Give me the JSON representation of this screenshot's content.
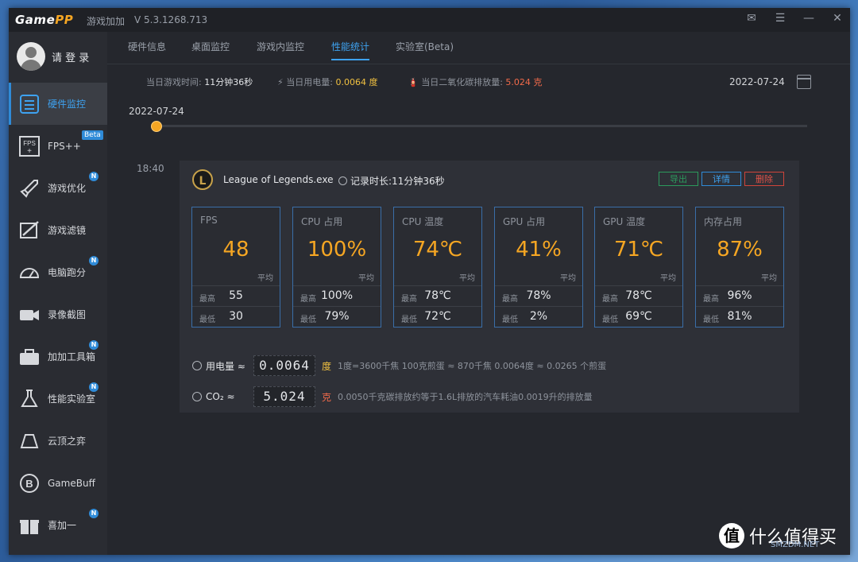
{
  "titlebar": {
    "app_name": "Game",
    "app_name_pp": "PP",
    "product": "游戏加加",
    "version": "V 5.3.1268.713",
    "icons": [
      "mail-icon",
      "settings-icon",
      "minimize-icon",
      "close-icon"
    ]
  },
  "sidebar": {
    "login": "请 登 录",
    "items": [
      {
        "label": "硬件监控",
        "icon": "hardware-monitor-icon",
        "active": true
      },
      {
        "label": "FPS++",
        "icon": "fps-icon",
        "badge": "Beta"
      },
      {
        "label": "游戏优化",
        "icon": "rocket-icon",
        "badge": "N"
      },
      {
        "label": "游戏滤镜",
        "icon": "filter-icon"
      },
      {
        "label": "电脑跑分",
        "icon": "speedometer-icon",
        "badge": "N"
      },
      {
        "label": "录像截图",
        "icon": "video-camera-icon"
      },
      {
        "label": "加加工具箱",
        "icon": "toolbox-icon",
        "badge": "N"
      },
      {
        "label": "性能实验室",
        "icon": "lab-flask-icon",
        "badge": "N"
      },
      {
        "label": "云顶之弈",
        "icon": "tft-icon"
      },
      {
        "label": "GameBuff",
        "icon": "gamebuff-icon"
      },
      {
        "label": "喜加一",
        "icon": "gift-icon",
        "badge": "N"
      }
    ]
  },
  "tabs": [
    {
      "label": "硬件信息"
    },
    {
      "label": "桌面监控"
    },
    {
      "label": "游戏内监控"
    },
    {
      "label": "性能统计",
      "active": true
    },
    {
      "label": "实验室(Beta)"
    }
  ],
  "summary": {
    "game_time_label": "当日游戏时间:",
    "game_time_value": "11分钟36秒",
    "power_label": "当日用电量:",
    "power_value": "0.0064 度",
    "co2_label": "当日二氧化碳排放量:",
    "co2_value": "5.024 克",
    "date": "2022-07-24"
  },
  "timeline": {
    "date": "2022-07-24"
  },
  "session": {
    "time": "18:40",
    "game_logo_letter": "L",
    "game": "League of Legends.exe",
    "record_label": "记录时长:",
    "record_value": "11分钟36秒",
    "buttons": {
      "export": "导出",
      "detail": "详情",
      "delete": "删除"
    },
    "avg_label": "平均",
    "max_label": "最高",
    "min_label": "最低",
    "metrics": [
      {
        "label": "FPS",
        "avg": "48",
        "max": "55",
        "min": "30"
      },
      {
        "label": "CPU 占用",
        "avg": "100%",
        "max": "100%",
        "min": "79%"
      },
      {
        "label": "CPU 温度",
        "avg": "74℃",
        "max": "78℃",
        "min": "72℃"
      },
      {
        "label": "GPU 占用",
        "avg": "41%",
        "max": "78%",
        "min": "2%"
      },
      {
        "label": "GPU 温度",
        "avg": "71℃",
        "max": "78℃",
        "min": "69℃"
      },
      {
        "label": "内存占用",
        "avg": "87%",
        "max": "96%",
        "min": "81%"
      }
    ],
    "power_row": {
      "title": "用电量 ≈",
      "value": "0.0064",
      "unit": "度",
      "note": "1度=3600千焦    100克煎蛋 ≈ 870千焦    0.0064度 ≈ 0.0265 个煎蛋"
    },
    "co2_row": {
      "title": "CO₂ ≈",
      "value": "5.024",
      "unit": "克",
      "note": "0.0050千克碳排放约等于1.6L排放的汽车耗油0.0019升的排放量"
    }
  },
  "watermark": {
    "logo": "值",
    "text": "什么值得买",
    "sub": "SMZDM.NET"
  },
  "colors": {
    "accent": "#3ea2f0",
    "value": "#f5a623",
    "export": "#2c9a5c",
    "delete": "#e05248"
  }
}
